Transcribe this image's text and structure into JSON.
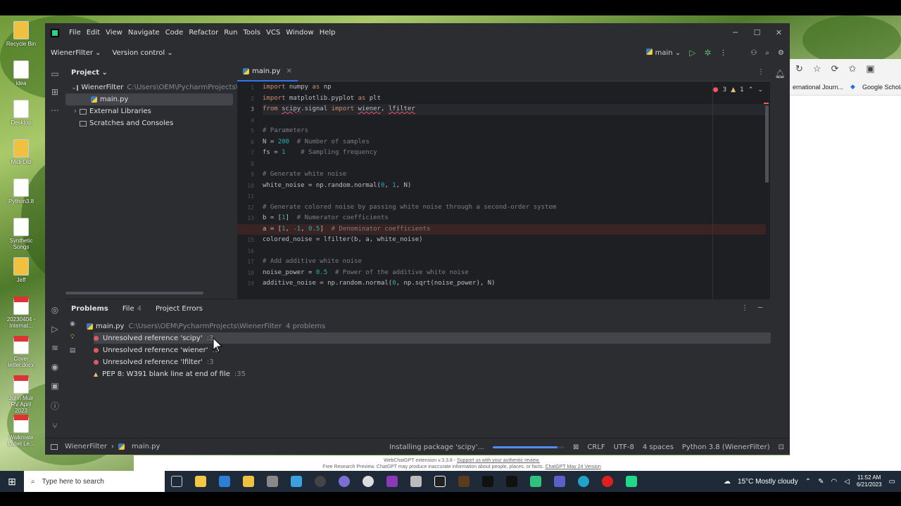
{
  "menu": [
    "File",
    "Edit",
    "View",
    "Navigate",
    "Code",
    "Refactor",
    "Run",
    "Tools",
    "VCS",
    "Window",
    "Help"
  ],
  "toolbar": {
    "project": "WienerFilter",
    "vcs": "Version control",
    "run_config": "main"
  },
  "project_panel": {
    "title": "Project",
    "root": "WienerFilter",
    "root_path": "C:\\Users\\OEM\\PycharmProjects\\W",
    "file": "main.py",
    "external": "External Libraries",
    "scratches": "Scratches and Consoles"
  },
  "editor": {
    "tab": "main.py",
    "errors": "3",
    "warnings": "1",
    "lines": [
      {
        "n": "1",
        "html": "<span class=\"kw\">import</span> numpy <span class=\"kw\">as</span> np"
      },
      {
        "n": "2",
        "html": "<span class=\"kw\">import</span> matplotlib.pyplot <span class=\"kw\">as</span> plt"
      },
      {
        "n": "3",
        "html": "<span class=\"kw\">from</span> <span class=\"err\">scipy</span>.signal <span class=\"kw\">import</span> <span class=\"err\">wiener</span>, <span class=\"err\">lfilter</span>"
      },
      {
        "n": "4",
        "html": ""
      },
      {
        "n": "5",
        "html": "<span class=\"cm\"># Parameters</span>"
      },
      {
        "n": "6",
        "html": "N = <span class=\"nm\">200</span>  <span class=\"cm\"># Number of samples</span>"
      },
      {
        "n": "7",
        "html": "fs = <span class=\"nm\">1</span>    <span class=\"cm\"># Sampling frequency</span>"
      },
      {
        "n": "8",
        "html": ""
      },
      {
        "n": "9",
        "html": "<span class=\"cm\"># Generate white noise</span>"
      },
      {
        "n": "10",
        "html": "white_noise = np.random.normal(<span class=\"nm\">0</span>, <span class=\"nm\">1</span>, N)"
      },
      {
        "n": "11",
        "html": ""
      },
      {
        "n": "12",
        "html": "<span class=\"cm\"># Generate colored noise by passing white noise through a second-order system</span>"
      },
      {
        "n": "13",
        "html": "b = [<span class=\"nm\">1</span>]  <span class=\"cm\"># Numerator coefficients</span>"
      },
      {
        "n": "14",
        "html": "a = [<span class=\"nm\">1</span>, <span class=\"nm\">-1</span>, <span class=\"nm\">0.5</span>]  <span class=\"cm\"># Denominator coefficients</span>"
      },
      {
        "n": "15",
        "html": "colored_noise = lfilter(b, a, white_noise)"
      },
      {
        "n": "16",
        "html": ""
      },
      {
        "n": "17",
        "html": "<span class=\"cm\"># Add additive white noise</span>"
      },
      {
        "n": "18",
        "html": "noise_power = <span class=\"nm\">0.5</span>  <span class=\"cm\"># Power of the additive white noise</span>"
      },
      {
        "n": "19",
        "html": "additive_noise = np.random.normal(<span class=\"nm\">0</span>, np.sqrt(noise_power), N)"
      }
    ]
  },
  "problems": {
    "tabs": {
      "problems": "Problems",
      "file": "File",
      "file_count": "4",
      "project": "Project Errors"
    },
    "file_row": {
      "name": "main.py",
      "path": "C:\\Users\\OEM\\PycharmProjects\\WienerFilter",
      "count": "4 problems"
    },
    "items": [
      {
        "kind": "error",
        "text": "Unresolved reference 'scipy'",
        "line": ":3"
      },
      {
        "kind": "error",
        "text": "Unresolved reference 'wiener'",
        "line": ":3"
      },
      {
        "kind": "error",
        "text": "Unresolved reference 'lfilter'",
        "line": ":3"
      },
      {
        "kind": "warning",
        "text": "PEP 8: W391 blank line at end of file",
        "line": ":35"
      }
    ]
  },
  "status": {
    "crumb_project": "WienerFilter",
    "crumb_file": "main.py",
    "task": "Installing package 'scipy'...",
    "progress": 0.9,
    "line_sep": "CRLF",
    "encoding": "UTF-8",
    "indent": "4 spaces",
    "interpreter": "Python 3.8 (WienerFilter)"
  },
  "browser": {
    "bookmark1": "ernational Journ...",
    "bookmark2": "Google Scholar"
  },
  "chatgpt_footer": {
    "line1": "WebChatGPT extension v.3.3.8 - ",
    "link": "Support us with your authentic review.",
    "line2": "Free Research Preview. ChatGPT may produce inaccurate information about people, places, or facts. ",
    "version": "ChatGPT May 24 Version"
  },
  "desktop_icons": [
    "Recycle Bin",
    "idea",
    "Desktop",
    "Midi Old",
    "Python3.8",
    "Synthetic Songs",
    "Jeff",
    "20230404 - Internat...",
    "Cover letter.docx",
    "John Muir RV April 2023",
    "Walkmate Label Le..."
  ],
  "taskbar": {
    "search": "Type here to search",
    "weather": "15°C  Mostly cloudy",
    "time": "11:52 AM",
    "date": "6/21/2023"
  }
}
